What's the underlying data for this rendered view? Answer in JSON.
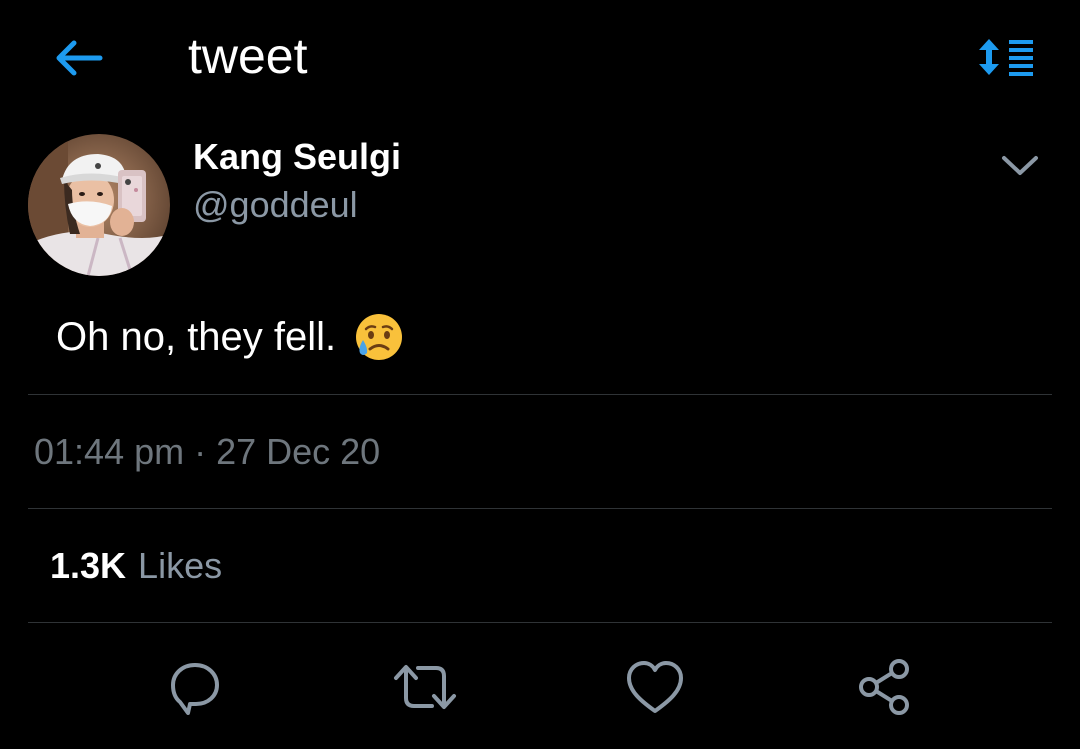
{
  "header": {
    "title": "tweet",
    "back_icon": "arrow-left-icon",
    "sort_icon": "sort-list-icon"
  },
  "tweet": {
    "author": {
      "name": "Kang Seulgi",
      "handle": "@goddeul"
    },
    "text": "Oh no, they fell.",
    "emoji": "sad-but-relieved-face-emoji",
    "timestamp": "01:44 pm · 27 Dec 20",
    "likes": {
      "count": "1.3K",
      "label": "Likes"
    }
  },
  "actions": [
    {
      "icon": "reply-icon"
    },
    {
      "icon": "retweet-icon"
    },
    {
      "icon": "like-icon"
    },
    {
      "icon": "share-icon"
    }
  ],
  "colors": {
    "background": "#000000",
    "accent": "#1d9bf0",
    "text_primary": "#ffffff",
    "text_secondary": "#8b98a5",
    "icon_gray": "#8b98a5",
    "divider": "#2f3336"
  }
}
